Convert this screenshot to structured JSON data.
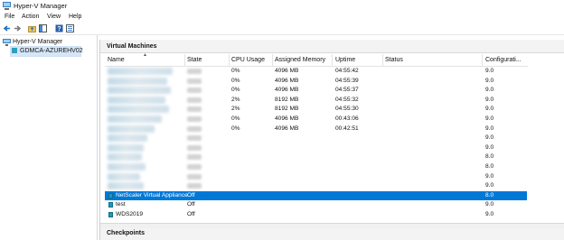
{
  "window": {
    "title": "Hyper-V Manager"
  },
  "menu": [
    "File",
    "Action",
    "View",
    "Help"
  ],
  "toolbar": {
    "icons": [
      "back-icon",
      "forward-icon",
      "up-folder-icon",
      "show-hide-tree-icon",
      "help-icon",
      "properties-icon"
    ]
  },
  "tree": {
    "root": "Hyper-V Manager",
    "server": "GDMCA-AZUREHV02"
  },
  "vm_panel": {
    "title": "Virtual Machines",
    "columns": [
      "Name",
      "State",
      "CPU Usage",
      "Assigned Memory",
      "Uptime",
      "Status",
      "Configurati..."
    ],
    "rows": [
      {
        "name": "",
        "state": "",
        "cpu": "0%",
        "memory": "4096 MB",
        "uptime": "04:55:42",
        "status": "",
        "config": "9.0",
        "blurred": true
      },
      {
        "name": "",
        "state": "",
        "cpu": "0%",
        "memory": "4096 MB",
        "uptime": "04:55:39",
        "status": "",
        "config": "9.0",
        "blurred": true
      },
      {
        "name": "",
        "state": "",
        "cpu": "0%",
        "memory": "4096 MB",
        "uptime": "04:55:37",
        "status": "",
        "config": "9.0",
        "blurred": true
      },
      {
        "name": "",
        "state": "",
        "cpu": "2%",
        "memory": "8192 MB",
        "uptime": "04:55:32",
        "status": "",
        "config": "9.0",
        "blurred": true
      },
      {
        "name": "",
        "state": "",
        "cpu": "2%",
        "memory": "8192 MB",
        "uptime": "04:55:30",
        "status": "",
        "config": "9.0",
        "blurred": true
      },
      {
        "name": "",
        "state": "",
        "cpu": "0%",
        "memory": "4096 MB",
        "uptime": "00:43:06",
        "status": "",
        "config": "9.0",
        "blurred": true
      },
      {
        "name": "",
        "state": "",
        "cpu": "0%",
        "memory": "4096 MB",
        "uptime": "00:42:51",
        "status": "",
        "config": "9.0",
        "blurred": true
      },
      {
        "name": "",
        "state": "",
        "cpu": "",
        "memory": "",
        "uptime": "",
        "status": "",
        "config": "9.0",
        "blurred": true
      },
      {
        "name": "",
        "state": "",
        "cpu": "",
        "memory": "",
        "uptime": "",
        "status": "",
        "config": "9.0",
        "blurred": true
      },
      {
        "name": "",
        "state": "",
        "cpu": "",
        "memory": "",
        "uptime": "",
        "status": "",
        "config": "8.0",
        "blurred": true
      },
      {
        "name": "",
        "state": "",
        "cpu": "",
        "memory": "",
        "uptime": "",
        "status": "",
        "config": "8.0",
        "blurred": true
      },
      {
        "name": "",
        "state": "",
        "cpu": "",
        "memory": "",
        "uptime": "",
        "status": "",
        "config": "9.0",
        "blurred": true
      },
      {
        "name": "",
        "state": "",
        "cpu": "",
        "memory": "",
        "uptime": "",
        "status": "",
        "config": "9.0",
        "blurred": true
      },
      {
        "name": "NetScaler Virtual Appliance",
        "state": "Off",
        "cpu": "",
        "memory": "",
        "uptime": "",
        "status": "",
        "config": "8.0",
        "blurred": false,
        "selected": true
      },
      {
        "name": "test",
        "state": "Off",
        "cpu": "",
        "memory": "",
        "uptime": "",
        "status": "",
        "config": "9.0",
        "blurred": false
      },
      {
        "name": "WDS2019",
        "state": "Off",
        "cpu": "",
        "memory": "",
        "uptime": "",
        "status": "",
        "config": "9.0",
        "blurred": false
      }
    ]
  },
  "checkpoints_panel": {
    "title": "Checkpoints"
  },
  "colors": {
    "selection": "#0078d7",
    "tree_selection": "#d6e6f7",
    "vm_icon": "#1c9ab8"
  }
}
